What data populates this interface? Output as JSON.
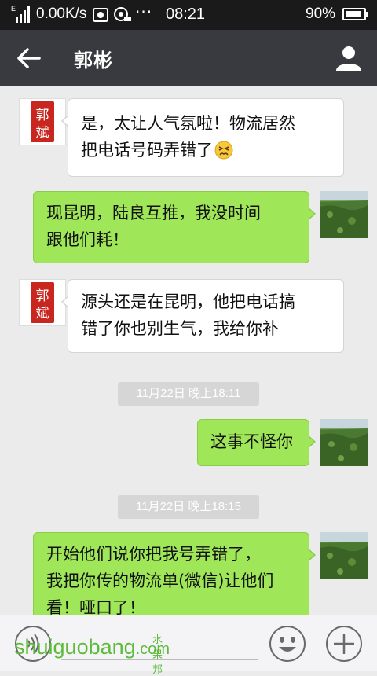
{
  "status_bar": {
    "network_type": "E",
    "speed": "0.00K/s",
    "overflow": "···",
    "time": "08:21",
    "battery": "90%",
    "battery_level": 0.9
  },
  "header": {
    "title": "郭彬",
    "back_icon": "back-arrow-icon",
    "profile_icon": "person-icon"
  },
  "seal_text": "郭斌",
  "messages": [
    {
      "direction": "in",
      "lines": [
        "是，太让人气氛啦！物流居然",
        "把电话号码弄错了"
      ],
      "emoji": "persevering-face"
    },
    {
      "direction": "out",
      "lines": [
        "现昆明，陆良互推，我没时间",
        "跟他们耗！"
      ]
    },
    {
      "direction": "in",
      "lines": [
        "源头还是在昆明，他把电话搞",
        "错了你也别生气，我给你补"
      ]
    },
    {
      "direction": "timestamp",
      "text": "11月22日 晚上18:11"
    },
    {
      "direction": "out",
      "lines": [
        "这事不怪你"
      ]
    },
    {
      "direction": "timestamp",
      "text": "11月22日 晚上18:15"
    },
    {
      "direction": "out",
      "lines": [
        "开始他们说你把我号弄错了，",
        "我把你传的物流单(微信)让他们",
        "看！哑口了！"
      ]
    }
  ],
  "input_bar": {
    "voice_icon": "voice-icon",
    "emoji_icon": "emoji-face-icon",
    "plus_icon": "plus-circle-icon"
  },
  "watermark": {
    "text": "shuiguobang",
    "suffix": ".com",
    "chinese": "水果邦"
  },
  "colors": {
    "title_bar": "#393a3f",
    "status_bar": "#1a1a1a",
    "chat_bg": "#ebebeb",
    "outgoing_bubble": "#9fe658",
    "incoming_bubble": "#ffffff",
    "watermark": "#5cbb3a"
  }
}
